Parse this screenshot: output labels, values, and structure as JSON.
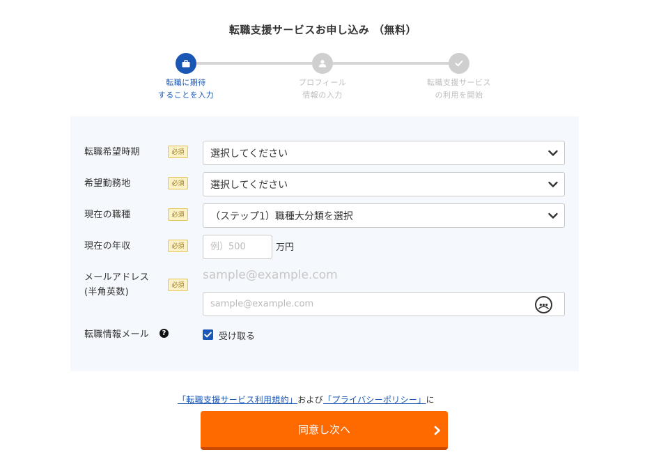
{
  "header": {
    "title": "転職支援サービスお申し込み （無料）"
  },
  "stepper": {
    "steps": [
      {
        "lines": [
          "転職に期待",
          "することを入力"
        ],
        "state": "active",
        "icon": "briefcase-icon"
      },
      {
        "lines": [
          "プロフィール",
          "情報の入力"
        ],
        "state": "inactive",
        "icon": "user-icon"
      },
      {
        "lines": [
          "転職支援サービス",
          "の利用を開始"
        ],
        "state": "inactive",
        "icon": "check-icon"
      }
    ]
  },
  "form": {
    "required_badge": "必須",
    "desired_timing": {
      "label": "転職希望時期",
      "value": "選択してください"
    },
    "desired_location": {
      "label": "希望勤務地",
      "value": "選択してください"
    },
    "current_job": {
      "label": "現在の職種",
      "value": "（ステップ1）職種大分類を選択"
    },
    "annual_income": {
      "label": "現在の年収",
      "placeholder": "例）500",
      "unit": "万円"
    },
    "email": {
      "label_lines": [
        "メールアドレス",
        "(半角英数)"
      ],
      "hint": "sample@example.com",
      "placeholder": "sample@example.com"
    },
    "job_mail": {
      "label": "転職情報メール",
      "help": "?",
      "checkbox_label": "受け取る",
      "checked": true
    }
  },
  "consent": {
    "terms_link": "「転職支援サービス利用規約」",
    "and_text": "および",
    "privacy_link": "「プライバシーポリシー」",
    "suffix": "に"
  },
  "submit": {
    "label": "同意し次へ"
  },
  "colors": {
    "accent": "#1a56b4",
    "submit": "#ff6a00",
    "required_bg": "#fdf2c7"
  }
}
